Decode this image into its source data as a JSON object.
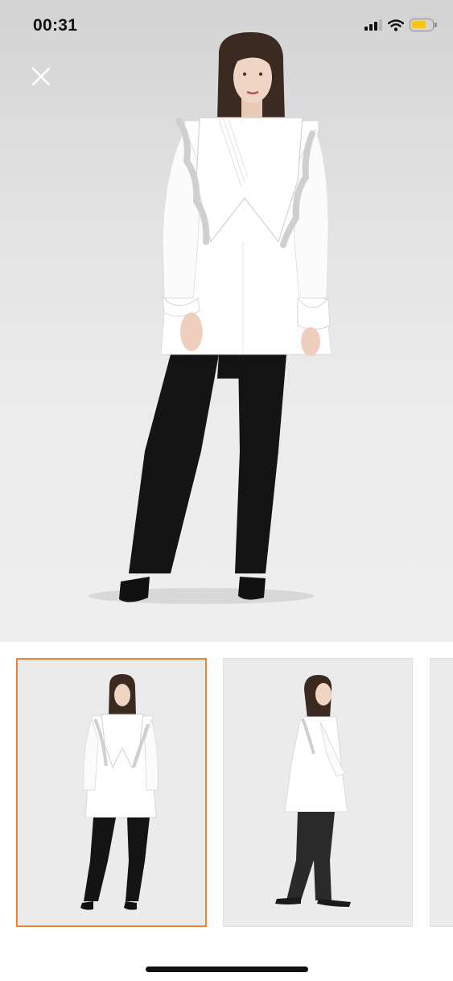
{
  "status_bar": {
    "time": "00:31",
    "icons": [
      "signal-icon",
      "wifi-icon",
      "battery-icon"
    ],
    "battery_level": 0.75,
    "battery_color": "#f5c518"
  },
  "viewer": {
    "close_icon": "close-icon",
    "main_image": "model-white-ruffle-blouse-black-pants-front",
    "selected_thumbnail": 1
  },
  "thumbnails": [
    {
      "image": "model-front-view",
      "selected": true
    },
    {
      "image": "model-side-view",
      "selected": false
    },
    {
      "image": "next-image-partial",
      "selected": false
    }
  ],
  "colors": {
    "selection_border": "#e8853a",
    "background": "#ffffff"
  }
}
